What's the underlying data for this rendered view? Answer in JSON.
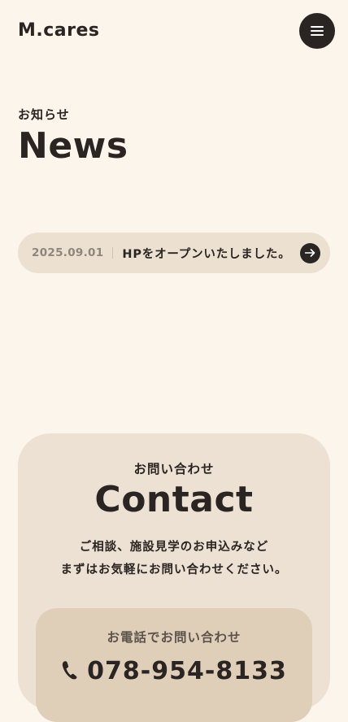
{
  "header": {
    "logo": "M.cares",
    "menu_icon": "hamburger-menu-icon"
  },
  "news": {
    "subtitle": "お知らせ",
    "title": "News",
    "items": [
      {
        "date": "2025.09.01",
        "text": "HPをオープンいたしました。",
        "icon": "arrow-right-icon"
      }
    ]
  },
  "contact": {
    "subtitle": "お問い合わせ",
    "title": "Contact",
    "description_line1": "ご相談、施設見学のお申込みなど",
    "description_line2": "まずはお気軽にお問い合わせください。",
    "phone": {
      "label": "お電話でお問い合わせ",
      "number": "078-954-8133",
      "icon": "phone-icon"
    }
  },
  "colors": {
    "background": "#fcf5ec",
    "text": "#2a2522",
    "news_pill": "#ece0d1",
    "contact_card": "#ece1d2",
    "phone_box": "#e0cfb8"
  }
}
